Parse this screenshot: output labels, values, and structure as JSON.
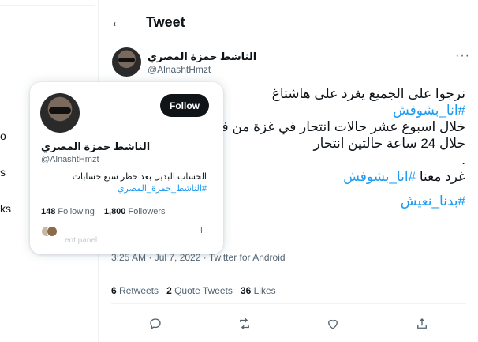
{
  "left_fragments": [
    "o",
    "s",
    "ks"
  ],
  "header": {
    "title": "Tweet"
  },
  "author": {
    "name": "الناشط حمزة المصري",
    "handle": "@AlnashtHmzt"
  },
  "tweet": {
    "line1": "نرجوا على الجميع يغرد على هاشتاغ",
    "hashtag1": "#انا_بشوفش",
    "line3": "خلال اسبوع عشر حالات انتحار في غزة من فـ",
    "line4": "خلال 24 ساعة حالتين انتحار",
    "dot": ".",
    "line6_text": "غرد معنا ",
    "line6_hashtag": "#انا_بشوفش",
    "hashtag2": "#بدنا_نعيش"
  },
  "timestamp": "3:25 AM · Jul 7, 2022 · Twitter for Android",
  "stats": {
    "retweets_count": "6",
    "retweets_label": "Retweets",
    "quotes_count": "2",
    "quotes_label": "Quote Tweets",
    "likes_count": "36",
    "likes_label": "Likes"
  },
  "hover_card": {
    "follow_label": "Follow",
    "name": "الناشط حمزة المصري",
    "handle": "@AlnashtHmzt",
    "bio": "الحساب البديل بعد حظر سبع حسابات",
    "bio_hashtag": "#الناشط_حمزة_المصري",
    "following_count": "148",
    "following_label": "Following",
    "followers_count": "1,800",
    "followers_label": "Followers",
    "mark": "I",
    "faded_text": "ent panel"
  },
  "colors": {
    "accent": "#1d9bf0",
    "text": "#0f1419",
    "muted": "#536471"
  }
}
